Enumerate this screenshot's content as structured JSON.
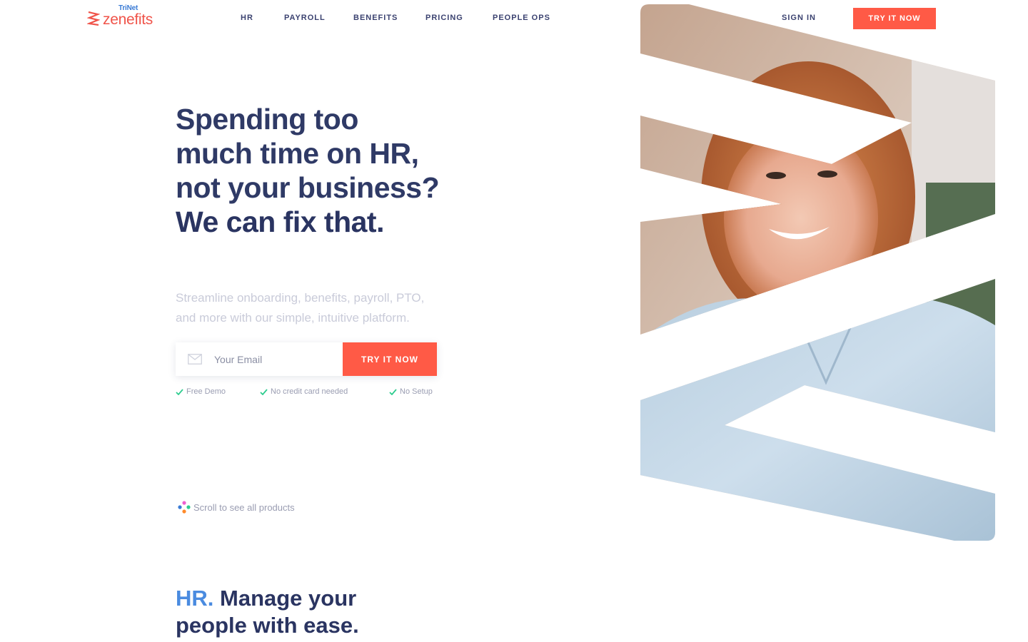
{
  "brand": {
    "company": "TriNet",
    "product": "zenefits",
    "accent_color": "#ff5a46",
    "logo_color": "#f0544a",
    "trinet_color": "#3a7bd5"
  },
  "nav": {
    "items": [
      {
        "label": "HR"
      },
      {
        "label": "PAYROLL"
      },
      {
        "label": "BENEFITS"
      },
      {
        "label": "PRICING"
      },
      {
        "label": "PEOPLE OPS"
      }
    ],
    "sign_in": "SIGN IN",
    "cta": "TRY IT NOW"
  },
  "hero": {
    "headline_lines": [
      "Spending too",
      "much time on HR,",
      "not your business?"
    ],
    "headline_strong": "We can fix that.",
    "subtext": "Streamline onboarding, benefits, payroll, PTO, and more with our simple, intuitive platform.",
    "email_placeholder": "Your Email",
    "email_value": "",
    "cta": "TRY IT NOW",
    "perks": [
      "Free Demo",
      "No credit card needed",
      "No Setup"
    ],
    "perk_check_color": "#2ecc8f"
  },
  "scroll_hint": {
    "label": "Scroll to see all products",
    "dot_colors": [
      "#ef5fd0",
      "#3a7bd5",
      "#2ecc8f",
      "#ff8a2a"
    ]
  },
  "section": {
    "accent": "HR.",
    "title_rest": " Manage your people with ease.",
    "accent_color": "#4a8be0"
  },
  "hero_image": {
    "alt": "Smiling woman with red hair in a light blue denim shirt",
    "shape": "zigzag"
  }
}
